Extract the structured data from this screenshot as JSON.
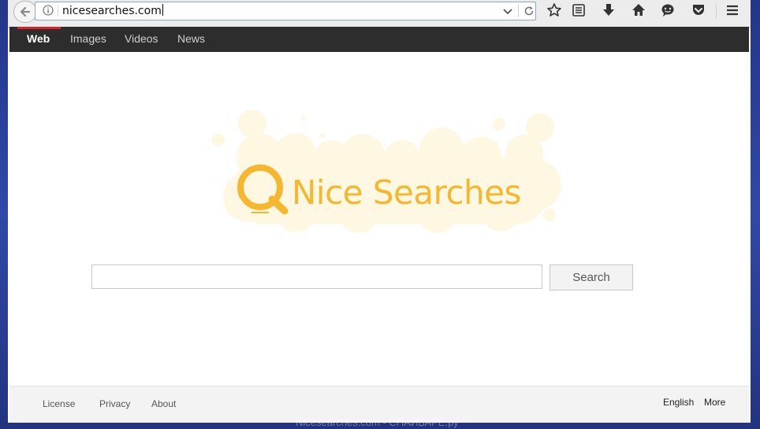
{
  "browser": {
    "url": "nicesearches.com"
  },
  "nav": {
    "items": [
      {
        "label": "Web",
        "active": true
      },
      {
        "label": "Images",
        "active": false
      },
      {
        "label": "Videos",
        "active": false
      },
      {
        "label": "News",
        "active": false
      }
    ]
  },
  "logo": {
    "text": "Nice Searches",
    "color": "#f5b72d",
    "cloud_color": "#fef7e2"
  },
  "search": {
    "input_value": "",
    "button_label": "Search"
  },
  "footer": {
    "left_links": [
      "License",
      "Privacy",
      "About"
    ],
    "right_links": [
      "English",
      "More"
    ]
  },
  "watermark": {
    "text": "Nicesearches.com - СПАЙВАРЕ.ру"
  },
  "icons": {
    "toolbar": [
      "back-arrow-icon",
      "info-icon",
      "dropdown-chevron-icon",
      "reload-icon",
      "bookmark-star-icon",
      "reading-list-icon",
      "download-icon",
      "home-icon",
      "chat-icon",
      "pocket-icon",
      "menu-hamburger-icon"
    ]
  }
}
